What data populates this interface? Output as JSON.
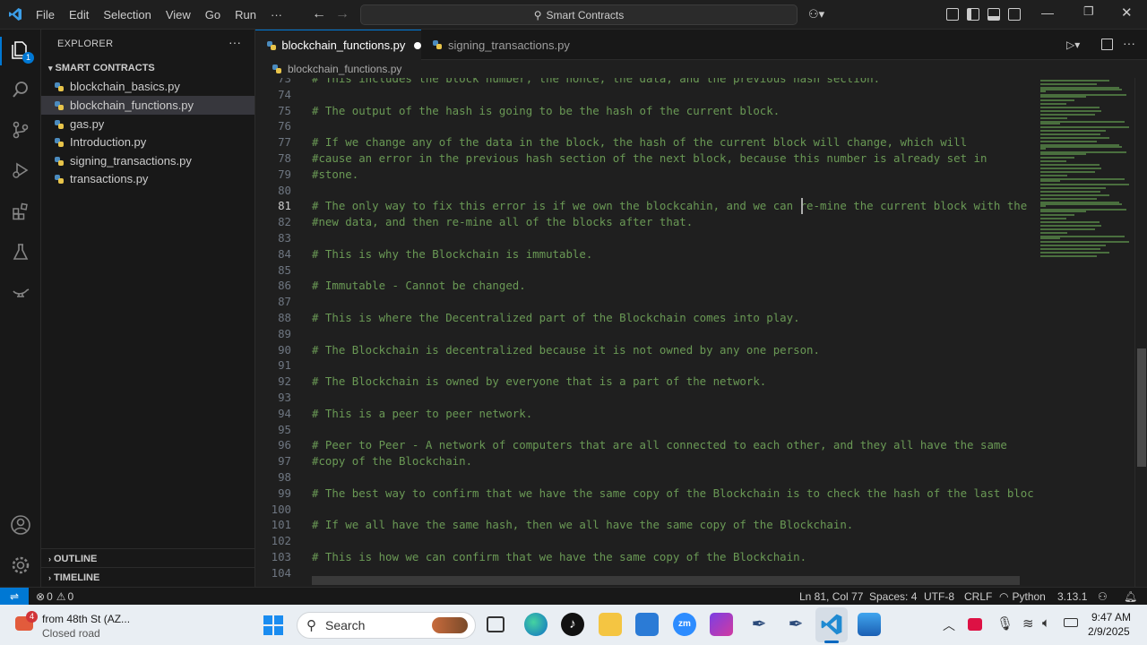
{
  "menu": [
    "File",
    "Edit",
    "Selection",
    "View",
    "Go",
    "Run",
    "···"
  ],
  "search": {
    "label": "Smart Contracts"
  },
  "explorer": {
    "title": "EXPLORER",
    "folder": "SMART CONTRACTS",
    "files": [
      {
        "name": "blockchain_basics.py",
        "active": false
      },
      {
        "name": "blockchain_functions.py",
        "active": true
      },
      {
        "name": "gas.py",
        "active": false
      },
      {
        "name": "Introduction.py",
        "active": false
      },
      {
        "name": "signing_transactions.py",
        "active": false
      },
      {
        "name": "transactions.py",
        "active": false
      }
    ],
    "outline": "OUTLINE",
    "timeline": "TIMELINE"
  },
  "activity_badge": "1",
  "tabs": [
    {
      "label": "blockchain_functions.py",
      "active": true,
      "modified": true
    },
    {
      "label": "signing_transactions.py",
      "active": false,
      "modified": false
    }
  ],
  "breadcrumb": "blockchain_functions.py",
  "editor": {
    "current_line": 81,
    "lines": [
      {
        "n": "73",
        "text": "# This includes the block number, the nonce, the data, and the previous hash section."
      },
      {
        "n": "74",
        "text": ""
      },
      {
        "n": "75",
        "text": "# The output of the hash is going to be the hash of the current block."
      },
      {
        "n": "76",
        "text": ""
      },
      {
        "n": "77",
        "text": "# If we change any of the data in the block, the hash of the current block will change, which will"
      },
      {
        "n": "78",
        "text": "#cause an error in the previous hash section of the next block, because this number is already set in"
      },
      {
        "n": "79",
        "text": "#stone."
      },
      {
        "n": "80",
        "text": ""
      },
      {
        "n": "81",
        "text": "# The only way to fix this error is if we own the blockcahin, and we can re-mine the current block with the"
      },
      {
        "n": "82",
        "text": "#new data, and then re-mine all of the blocks after that."
      },
      {
        "n": "83",
        "text": ""
      },
      {
        "n": "84",
        "text": "# This is why the Blockchain is immutable."
      },
      {
        "n": "85",
        "text": ""
      },
      {
        "n": "86",
        "text": "# Immutable - Cannot be changed."
      },
      {
        "n": "87",
        "text": ""
      },
      {
        "n": "88",
        "text": "# This is where the Decentralized part of the Blockchain comes into play."
      },
      {
        "n": "89",
        "text": ""
      },
      {
        "n": "90",
        "text": "# The Blockchain is decentralized because it is not owned by any one person."
      },
      {
        "n": "91",
        "text": ""
      },
      {
        "n": "92",
        "text": "# The Blockchain is owned by everyone that is a part of the network."
      },
      {
        "n": "93",
        "text": ""
      },
      {
        "n": "94",
        "text": "# This is a peer to peer network."
      },
      {
        "n": "95",
        "text": ""
      },
      {
        "n": "96",
        "text": "# Peer to Peer - A network of computers that are all connected to each other, and they all have the same"
      },
      {
        "n": "97",
        "text": "#copy of the Blockchain."
      },
      {
        "n": "98",
        "text": ""
      },
      {
        "n": "99",
        "text": "# The best way to confirm that we have the same copy of the Blockchain is to check the hash of the last block."
      },
      {
        "n": "100",
        "text": ""
      },
      {
        "n": "101",
        "text": "# If we all have the same hash, then we all have the same copy of the Blockchain."
      },
      {
        "n": "102",
        "text": ""
      },
      {
        "n": "103",
        "text": "# This is how we can confirm that we have the same copy of the Blockchain."
      },
      {
        "n": "104",
        "text": ""
      }
    ]
  },
  "statusbar": {
    "problems": "0",
    "warnings": "0",
    "position": "Ln 81, Col 77",
    "spaces": "Spaces: 4",
    "encoding": "UTF-8",
    "eol": "CRLF",
    "language": "Python",
    "version": "3.13.1"
  },
  "taskbar": {
    "weather_badge": "4",
    "weather_title": "from 48th St (AZ...",
    "weather_sub": "Closed road",
    "search": "Search",
    "time": "9:47 AM",
    "date": "2/9/2025"
  },
  "colors": {
    "comment": "#6a9955",
    "accent": "#0078d4",
    "editor_bg": "#1f1f1f"
  }
}
